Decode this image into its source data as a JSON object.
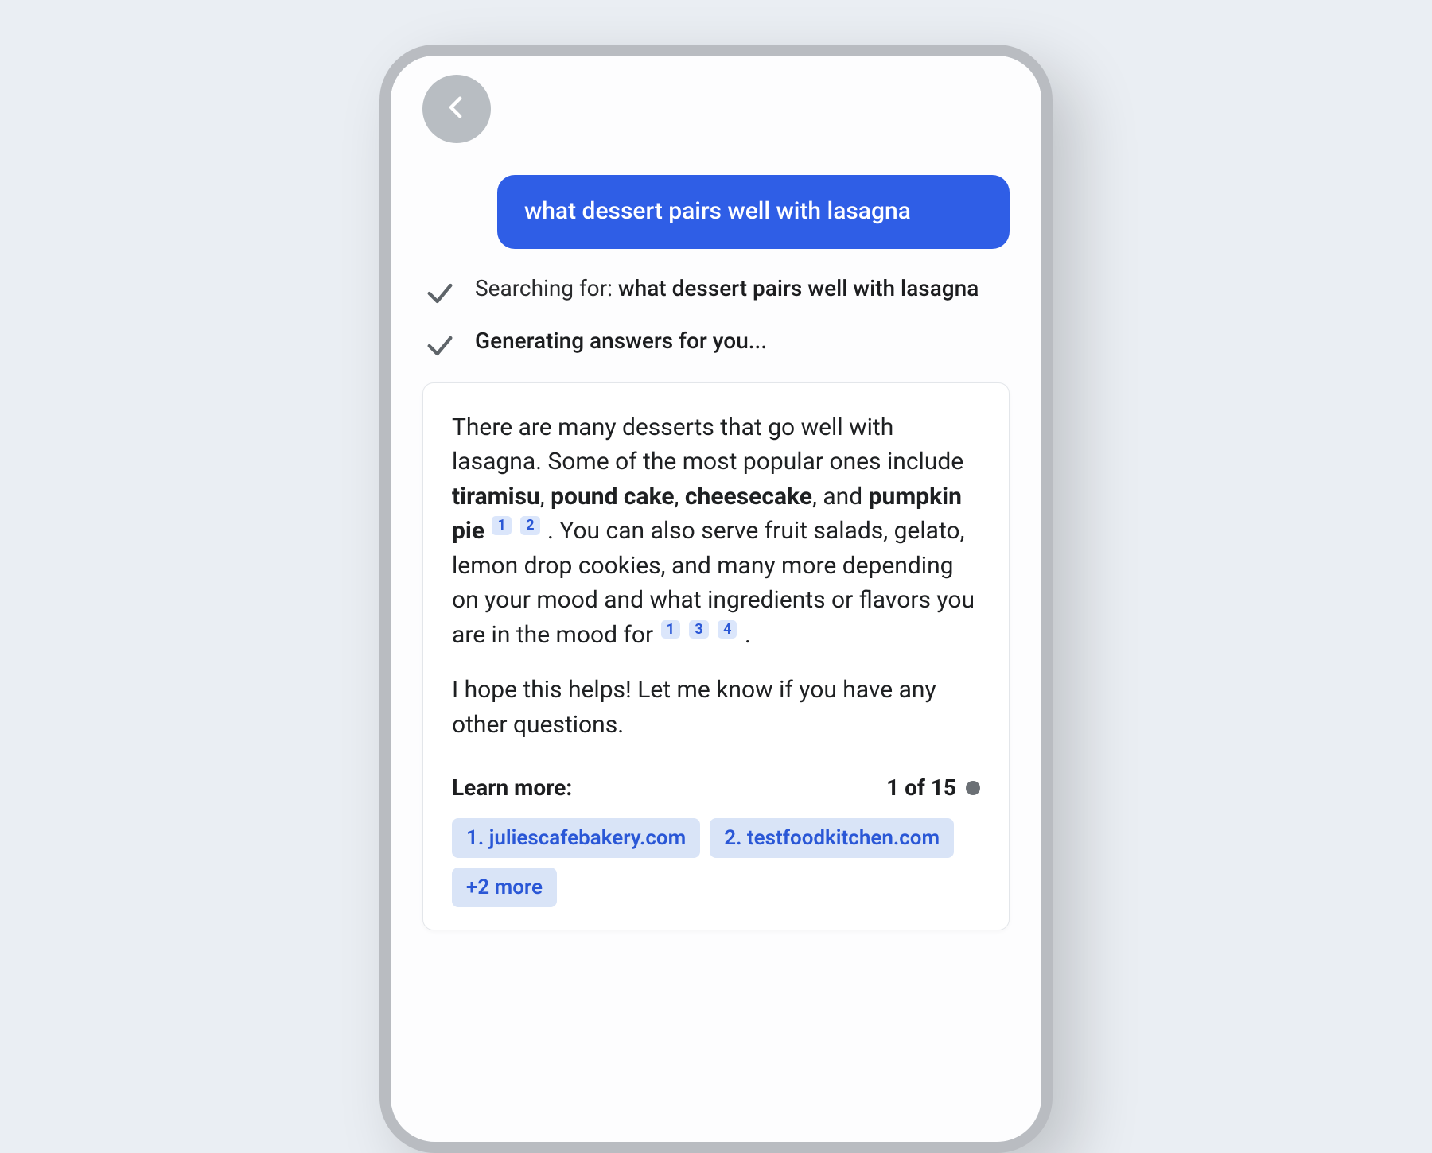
{
  "colors": {
    "user_bubble_bg": "#2f5ee6",
    "accent_blue": "#2a57d6",
    "chip_bg": "#d9e4f7",
    "cite_bg": "#dbe6fb",
    "page_bg": "#eaeef3"
  },
  "user_message": "what dessert pairs well with lasagna",
  "status": {
    "searching_prefix": "Searching for: ",
    "searching_query": "what dessert pairs well with lasagna",
    "generating": "Generating answers for you..."
  },
  "answer": {
    "para1_pre": "There are many desserts that go well with lasagna. Some of the most popular ones include ",
    "bold1": "tiramisu",
    "sep1": ", ",
    "bold2": "pound cake",
    "sep2": ", ",
    "bold3": "cheesecake",
    "sep3": ", and ",
    "bold4": "pumpkin pie",
    "cite1": "1",
    "cite2": "2",
    "para1_mid": " . You can also serve fruit salads, gelato, lemon drop cookies, and many more depending on your mood and what ingredients or flavors you are in the mood for ",
    "cite3": "1",
    "cite4": "3",
    "cite5": "4",
    "para1_end": " .",
    "para2": "I hope this helps! Let me know if you have any other questions."
  },
  "learn_more": {
    "label": "Learn more:",
    "count": "1 of 15",
    "sources": [
      "1. juliescafebakery.com",
      "2. testfoodkitchen.com"
    ],
    "more_chip": "+2 more"
  }
}
